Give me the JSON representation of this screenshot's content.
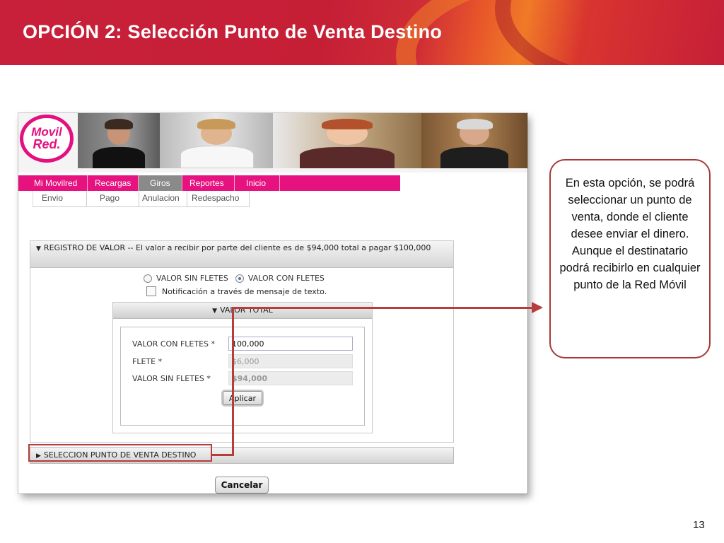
{
  "slide": {
    "title": "OPCIÓN 2: Selección Punto de Venta Destino",
    "page_number": "13",
    "callout_text": "En esta opción, se podrá seleccionar un punto de venta, donde el cliente desee enviar el dinero. Aunque el destinatario podrá recibirlo en cualquier punto de la Red Móvil"
  },
  "app": {
    "logo_line1": "Movil",
    "logo_line2": "Red.",
    "nav": {
      "items": [
        "Mi Movilred",
        "Recargas",
        "Giros",
        "Reportes",
        "Inicio"
      ],
      "active": "Giros"
    },
    "subnav": {
      "items": [
        "Envio",
        "Pago",
        "Anulacion",
        "Redespacho"
      ]
    },
    "registro": {
      "header": "REGISTRO DE VALOR -- El valor a recibir por parte del cliente es de $94,000 total a pagar $100,000",
      "radio_sin_fletes": "VALOR SIN FLETES",
      "radio_con_fletes": "VALOR CON FLETES",
      "selected_radio": "VALOR CON FLETES",
      "notificacion_label": "Notificación a través de mensaje de texto.",
      "valor_total": {
        "header": "VALOR TOTAL",
        "fields": [
          {
            "label": "VALOR CON FLETES *",
            "value": "100,000"
          },
          {
            "label": "FLETE *",
            "value": "$6,000"
          },
          {
            "label": "VALOR SIN FLETES *",
            "value": "$94,000"
          }
        ],
        "aplicar_label": "Aplicar"
      }
    },
    "seleccion_header": "SELECCION PUNTO DE VENTA DESTINO",
    "cancelar_label": "Cancelar"
  },
  "colors": {
    "header_red": "#c8203a",
    "nav_pink": "#e5127f",
    "nav_active_gray": "#8a8a8a",
    "annotation_red": "#b73c3c"
  }
}
